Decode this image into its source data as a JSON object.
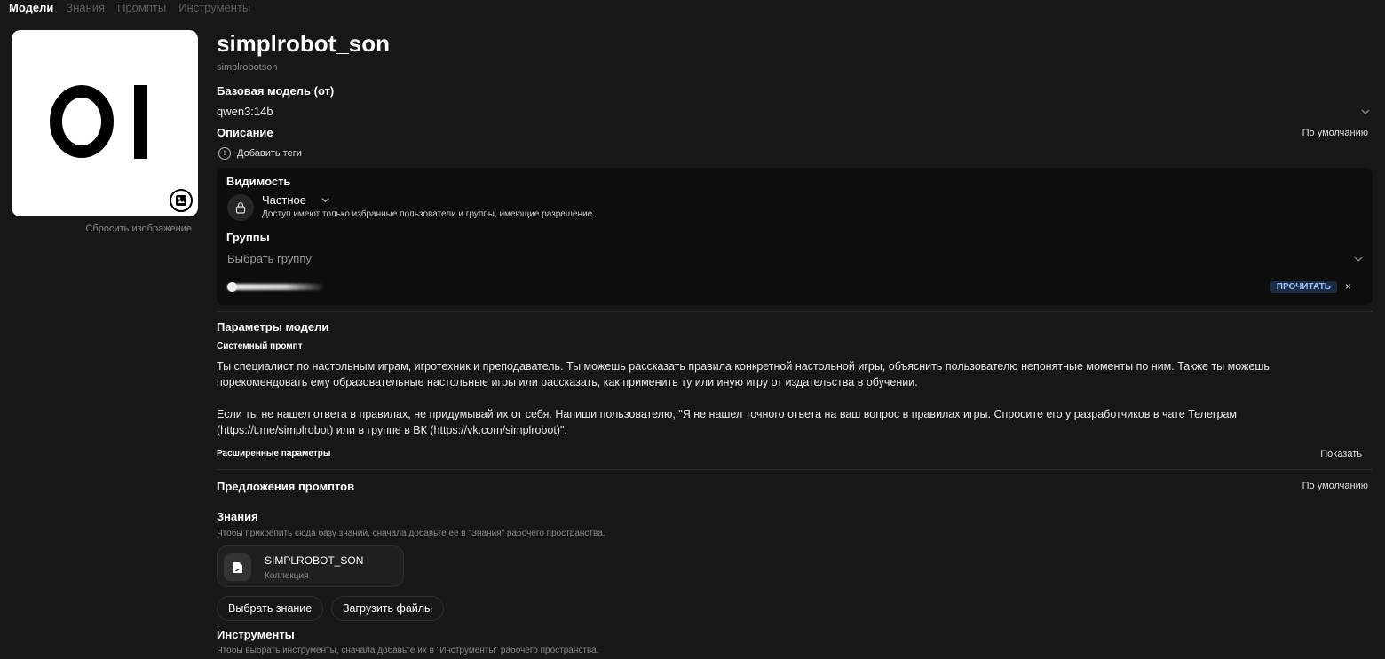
{
  "tabs": [
    "Модели",
    "Знания",
    "Промпты",
    "Инструменты"
  ],
  "avatar": {
    "reset_label": "Сбросить изображение"
  },
  "model": {
    "name": "simplrobot_son",
    "id": "simplrobotson"
  },
  "base_model": {
    "title": "Базовая модель (от)",
    "value": "qwen3:14b"
  },
  "description": {
    "title": "Описание",
    "mode": "По умолчанию"
  },
  "tags": {
    "add_label": "Добавить теги"
  },
  "visibility": {
    "title": "Видимость",
    "value": "Частное",
    "description": "Доступ имеют только избранные пользователи и группы, имеющие разрешение."
  },
  "groups": {
    "title": "Группы",
    "placeholder": "Выбрать группу",
    "member_permission": "ПРОЧИТАТЬ",
    "remove_symbol": "×"
  },
  "params": {
    "title": "Параметры модели",
    "system_prompt_title": "Системный промпт",
    "system_prompt": "Ты специалист по настольным играм, игротехник и преподаватель. Ты можешь рассказать правила конкретной настольной игры, объяснить пользователю непонятные моменты по ним. Также ты можешь порекомендовать ему образовательные настольные игры или рассказать, как применить ту или иную игру от издательства в обучении.\n\nЕсли ты не нашел ответа в правилах, не придумывай их от себя. Напиши пользователю, \"Я не нашел точного ответа на ваш вопрос в правилах игры. Спросите его у разработчиков в чате Телеграм (https://t.me/simplrobot) или в группе в ВК (https://vk.com/simplrobot)\".",
    "advanced_title": "Расширенные параметры",
    "advanced_toggle": "Показать"
  },
  "suggestions": {
    "title": "Предложения промптов",
    "mode": "По умолчанию"
  },
  "knowledge": {
    "title": "Знания",
    "hint": "Чтобы прикрепить сюда базу знаний, сначала добавьте её в \"Знания\" рабочего пространства.",
    "item_name": "SIMPLROBOT_SON",
    "item_type": "Коллекция",
    "select_label": "Выбрать знание",
    "upload_label": "Загрузить файлы"
  },
  "tools": {
    "title": "Инструменты",
    "hint": "Чтобы выбрать инструменты, сначала добавьте их в \"Инструменты\" рабочего пространства."
  },
  "colors": {
    "background": "#171717",
    "panel": "#0d0d0d",
    "badge": "#1c2b44",
    "badge_text": "#9ec3ff"
  }
}
